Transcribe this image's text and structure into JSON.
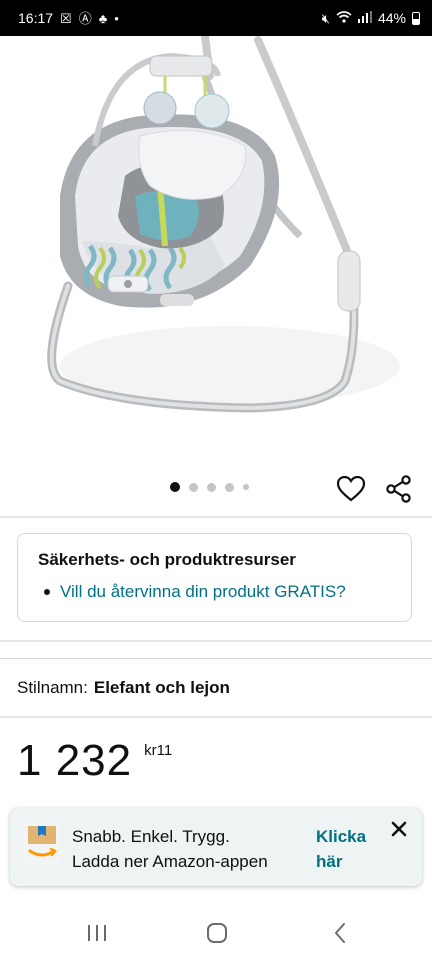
{
  "status_bar": {
    "time": "16:17",
    "battery": "44%"
  },
  "product": {
    "image_label": "baby-swing-elephant-lion",
    "carousel_dots": 5,
    "active_dot": 0
  },
  "resources": {
    "title": "Säkerhets- och produktresurser",
    "link": "Vill du återvinna din produkt GRATIS?"
  },
  "style": {
    "label": "Stilnamn:",
    "value": "Elefant och lejon"
  },
  "price": {
    "whole": "1 232",
    "fraction": "kr11"
  },
  "app_banner": {
    "line1": "Snabb. Enkel. Trygg.",
    "line2": "Ladda ner Amazon-appen",
    "cta_line1": "Klicka",
    "cta_line2": "här",
    "close": "✕"
  },
  "colors": {
    "link": "#007185",
    "text": "#0f1111",
    "banner_bg": "#eef3f3"
  }
}
